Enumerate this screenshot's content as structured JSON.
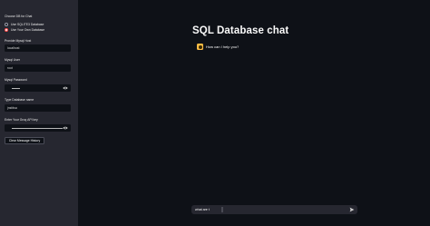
{
  "sidebar": {
    "choose_label": "Choose DB for Chat",
    "options": [
      {
        "label": "Use SQLITE3 Database",
        "selected": false
      },
      {
        "label": "Use Your Own Database",
        "selected": true
      }
    ],
    "host": {
      "label": "Provide Mysql Host",
      "value": "localhost"
    },
    "user": {
      "label": "Mysql User",
      "value": "root"
    },
    "password": {
      "label": "Mysql Password",
      "masked": true
    },
    "database": {
      "label": "Type Database name",
      "value": "jnsfdsa"
    },
    "api_key": {
      "label": "Enter Your Groq API key",
      "masked": true
    },
    "clear_button": "Clear Message History"
  },
  "main": {
    "title": "SQL Database chat",
    "messages": [
      {
        "role": "assistant",
        "text": "How can I help you?"
      }
    ],
    "chat_input": {
      "value": "what are t"
    }
  },
  "colors": {
    "background": "#0e1117",
    "sidebar": "#262730",
    "accent": "#ff4b4b",
    "avatar": "#ffbd45"
  },
  "icons": {
    "show_password": "eye-icon",
    "send": "send-icon",
    "assistant_avatar": "bot-avatar-icon"
  }
}
